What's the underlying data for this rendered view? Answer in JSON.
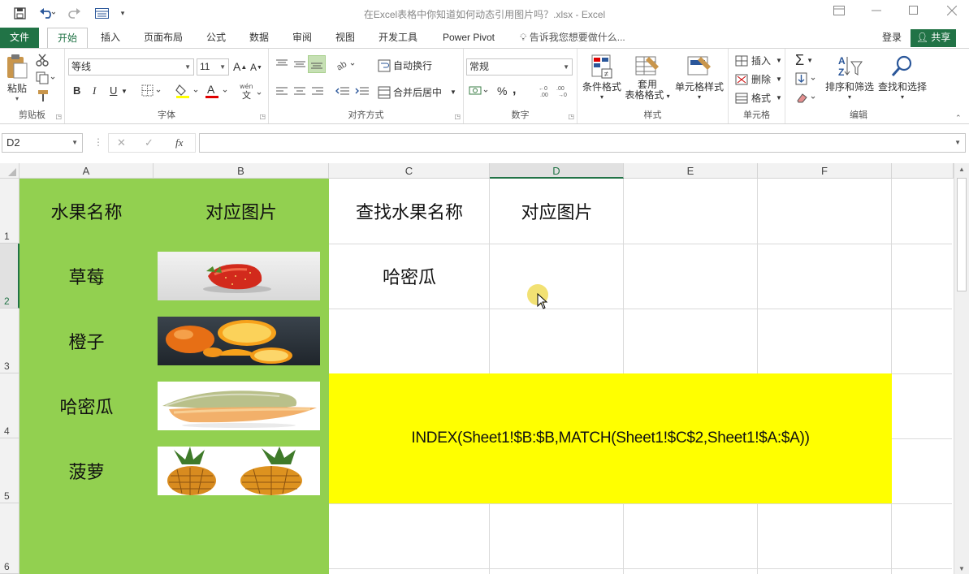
{
  "titlebar": {
    "title": "在Excel表格中你知道如何动态引用图片吗？.xlsx - Excel"
  },
  "tabs": {
    "file": "文件",
    "home": "开始",
    "insert": "插入",
    "page_layout": "页面布局",
    "formulas": "公式",
    "data": "数据",
    "review": "审阅",
    "view": "视图",
    "developer": "开发工具",
    "power_pivot": "Power Pivot",
    "tell_me": "告诉我您想要做什么...",
    "login": "登录",
    "share": "共享"
  },
  "ribbon": {
    "clipboard": {
      "label": "剪贴板",
      "paste": "粘贴"
    },
    "font": {
      "label": "字体",
      "font_name": "等线",
      "font_size": "11",
      "bold": "B",
      "italic": "I",
      "underline": "U"
    },
    "alignment": {
      "label": "对齐方式",
      "wrap": "自动换行",
      "merge": "合并后居中"
    },
    "number": {
      "label": "数字",
      "format": "常规",
      "percent": "%",
      "comma": ","
    },
    "styles": {
      "label": "样式",
      "conditional": "条件格式",
      "table_format_1": "套用",
      "table_format_2": "表格格式",
      "cell_styles": "单元格样式"
    },
    "cells": {
      "label": "单元格",
      "insert": "插入",
      "delete": "删除",
      "format": "格式"
    },
    "editing": {
      "label": "编辑",
      "sort": "排序和筛选",
      "find": "查找和选择"
    }
  },
  "formula_bar": {
    "name_box": "D2",
    "fx": "fx",
    "value": ""
  },
  "columns": [
    "A",
    "B",
    "C",
    "D",
    "E",
    "F"
  ],
  "rows": [
    "1",
    "2",
    "3",
    "4",
    "5",
    "6"
  ],
  "cells": {
    "a1": "水果名称",
    "b1": "对应图片",
    "c1": "查找水果名称",
    "d1": "对应图片",
    "a2": "草莓",
    "c2": "哈密瓜",
    "a3": "橙子",
    "a4": "哈密瓜",
    "a5": "菠萝",
    "formula": "INDEX(Sheet1!$B:$B,MATCH(Sheet1!$C$2,Sheet1!$A:$A))"
  },
  "colors": {
    "excel_green": "#217346",
    "fill_green": "#92d050",
    "fill_yellow": "#ffff00"
  },
  "pictures": [
    {
      "name": "strawberry-picture"
    },
    {
      "name": "orange-picture"
    },
    {
      "name": "cantaloupe-picture"
    },
    {
      "name": "pineapple-picture"
    }
  ]
}
